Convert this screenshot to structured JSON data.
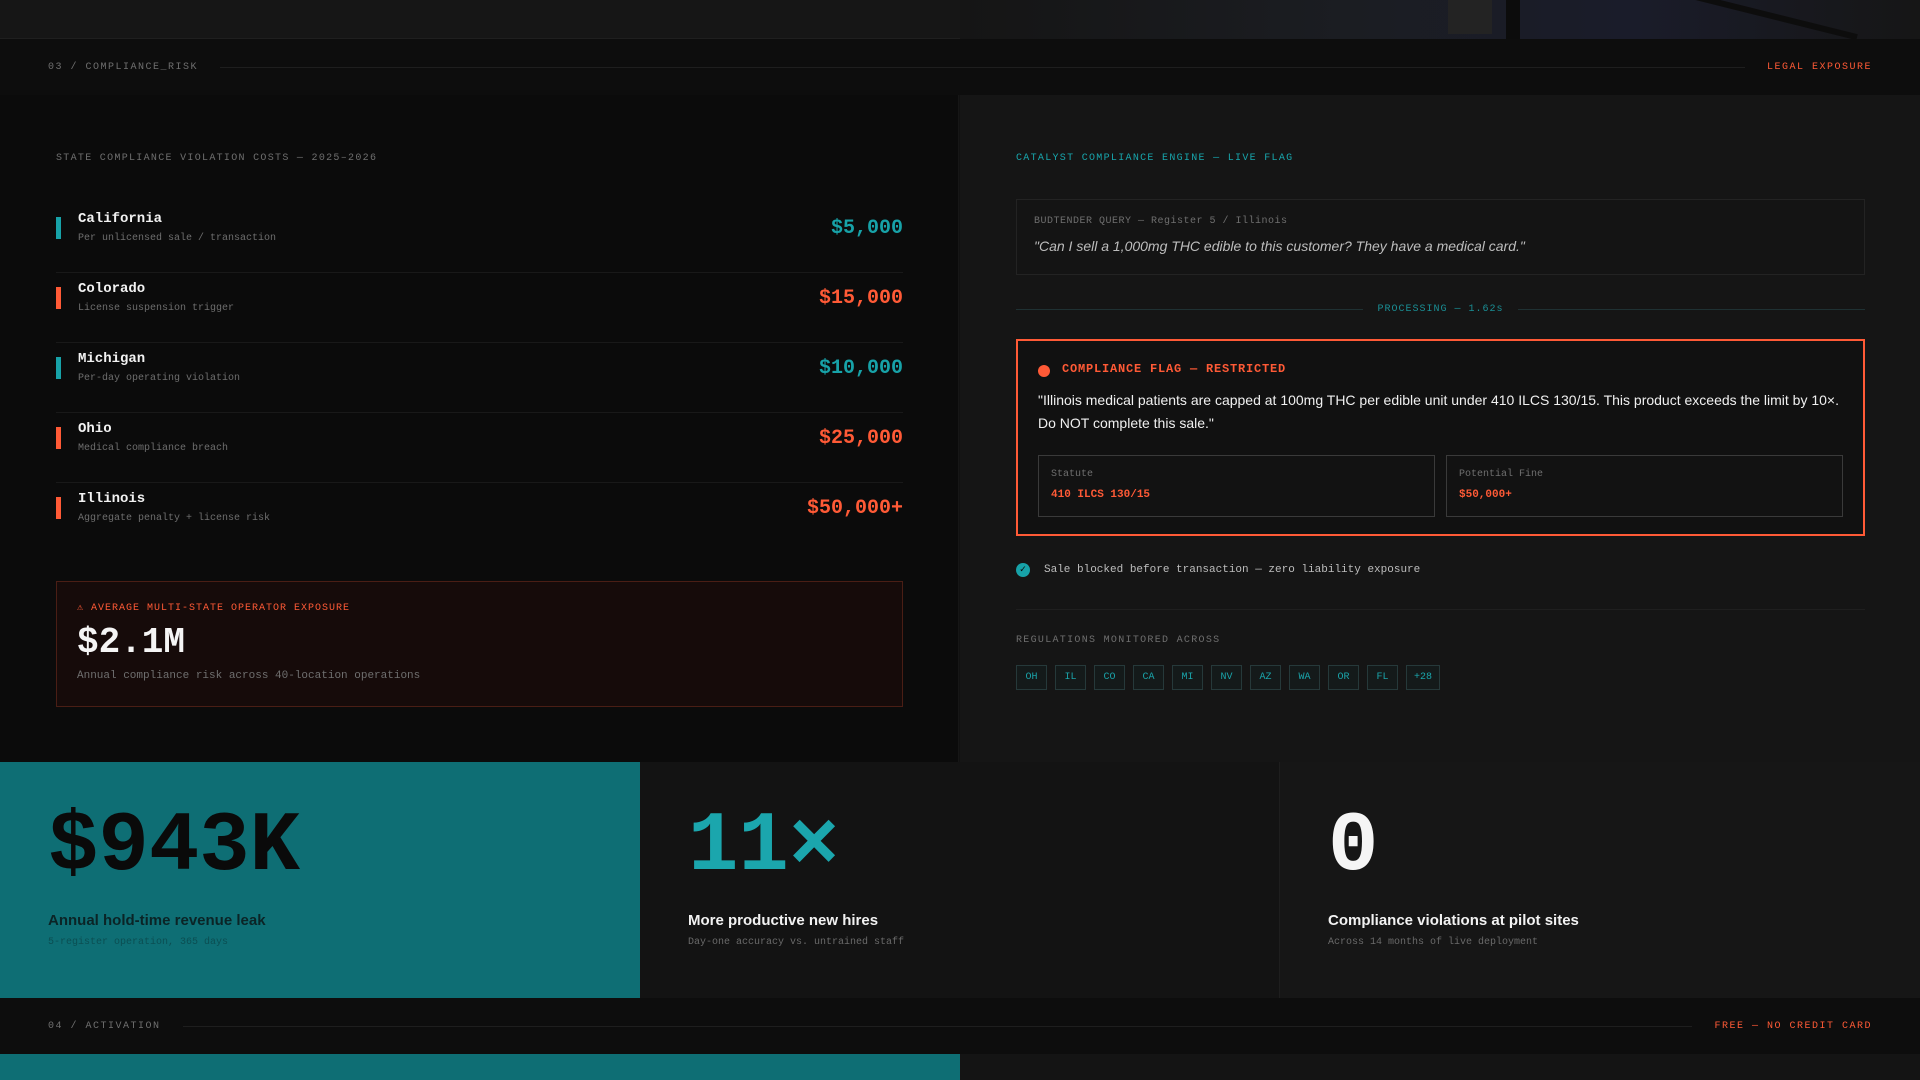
{
  "section_03": {
    "label": "03 / COMPLIANCE_RISK",
    "tag": "LEGAL EXPOSURE"
  },
  "violations": {
    "heading": "STATE COMPLIANCE VIOLATION COSTS — 2025–2026",
    "states": [
      {
        "name": "California",
        "desc": "Per unlicensed sale / transaction",
        "amount": "$5,000",
        "color": "#17a2a8"
      },
      {
        "name": "Colorado",
        "desc": "License suspension trigger",
        "amount": "$15,000",
        "color": "#ff5a36"
      },
      {
        "name": "Michigan",
        "desc": "Per-day operating violation",
        "amount": "$10,000",
        "color": "#17a2a8"
      },
      {
        "name": "Ohio",
        "desc": "Medical compliance breach",
        "amount": "$25,000",
        "color": "#ff5a36"
      },
      {
        "name": "Illinois",
        "desc": "Aggregate penalty + license risk",
        "amount": "$50,000+",
        "color": "#ff5a36"
      }
    ],
    "exposure": {
      "icon": "warning-icon",
      "title": "⚠ AVERAGE MULTI-STATE OPERATOR EXPOSURE",
      "value": "$2.1M",
      "note": "Annual compliance risk across 40-location operations"
    }
  },
  "engine": {
    "heading": "CATALYST COMPLIANCE ENGINE — LIVE FLAG",
    "query_label": "BUDTENDER QUERY — Register 5 / Illinois",
    "query_text": "\"Can I sell a 1,000mg THC edible to this customer? They have a medical card.\"",
    "processing": "PROCESSING — 1.62s",
    "flag_title": "COMPLIANCE FLAG — RESTRICTED",
    "flag_text": "\"Illinois medical patients are capped at 100mg THC per edible unit under 410 ILCS 130/15. This product exceeds the limit by 10×. Do NOT complete this sale.\"",
    "statute_label": "Statute",
    "statute_value": "410 ILCS 130/15",
    "fine_label": "Potential Fine",
    "fine_value": "$50,000+",
    "blocked_icon": "check-circle-icon",
    "blocked_text": "Sale blocked before transaction — zero liability exposure",
    "monitored_label": "REGULATIONS MONITORED ACROSS",
    "states": [
      "OH",
      "IL",
      "CO",
      "CA",
      "MI",
      "NV",
      "AZ",
      "WA",
      "OR",
      "FL",
      "+28"
    ]
  },
  "stats": {
    "leak": {
      "value": "$943K",
      "title": "Annual hold-time revenue leak",
      "sub": "5-register operation, 365 days"
    },
    "hires": {
      "value": "11×",
      "title": "More productive new hires",
      "sub": "Day-one accuracy vs. untrained staff"
    },
    "violations": {
      "value": "0",
      "title": "Compliance violations at pilot sites",
      "sub": "Across 14 months of live deployment"
    }
  },
  "section_04": {
    "label": "04 / ACTIVATION",
    "tag": "FREE — NO CREDIT CARD"
  },
  "colors": {
    "accent_teal": "#17a2a8",
    "accent_orange": "#ff5a36",
    "panel_dark": "#0b0b0b"
  }
}
